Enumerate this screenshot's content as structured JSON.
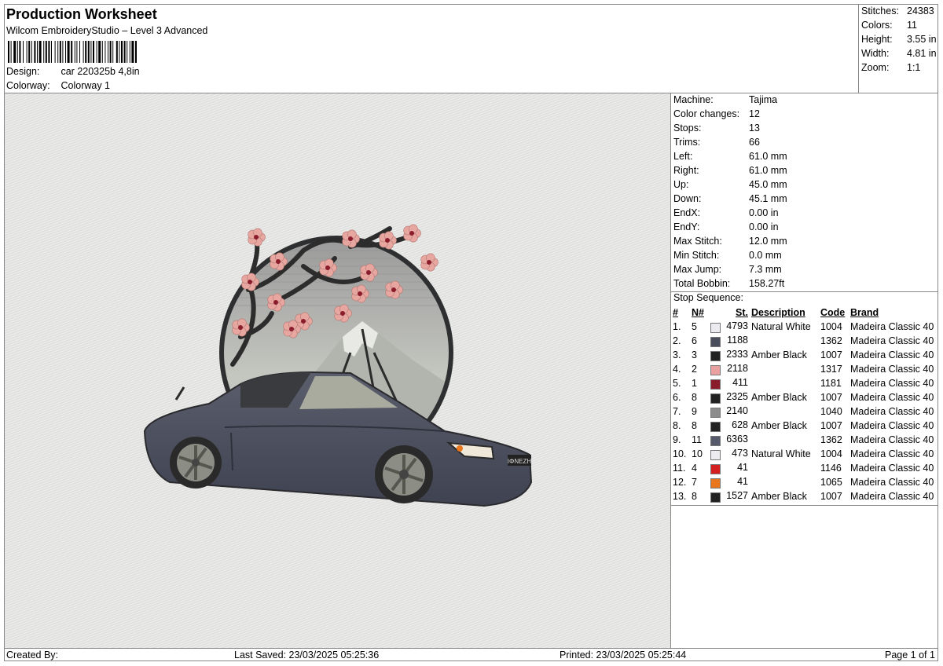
{
  "header": {
    "title": "Production Worksheet",
    "subtitle": "Wilcom EmbroideryStudio – Level 3 Advanced",
    "design_label": "Design:",
    "design_value": "car 220325b 4,8in",
    "colorway_label": "Colorway:",
    "colorway_value": "Colorway 1"
  },
  "stats": [
    {
      "k": "Stitches:",
      "v": "24383"
    },
    {
      "k": "Colors:",
      "v": "11"
    },
    {
      "k": "Height:",
      "v": "3.55 in"
    },
    {
      "k": "Width:",
      "v": "4.81 in"
    },
    {
      "k": "Zoom:",
      "v": "1:1"
    }
  ],
  "machine": [
    {
      "k": "Machine:",
      "v": "Tajima"
    },
    {
      "k": "Color changes:",
      "v": "12"
    },
    {
      "k": "Stops:",
      "v": "13"
    },
    {
      "k": "Trims:",
      "v": "66"
    },
    {
      "k": "Left:",
      "v": "61.0 mm"
    },
    {
      "k": "Right:",
      "v": "61.0 mm"
    },
    {
      "k": "Up:",
      "v": "45.0 mm"
    },
    {
      "k": "Down:",
      "v": "45.1 mm"
    },
    {
      "k": "EndX:",
      "v": "0.00 in"
    },
    {
      "k": "EndY:",
      "v": "0.00 in"
    },
    {
      "k": "Max Stitch:",
      "v": "12.0 mm"
    },
    {
      "k": "Min Stitch:",
      "v": "0.0 mm"
    },
    {
      "k": "Max Jump:",
      "v": "7.3 mm"
    },
    {
      "k": "Total Bobbin:",
      "v": "158.27ft"
    }
  ],
  "stop_sequence": {
    "title": "Stop Sequence:",
    "headers": [
      "#",
      "N#",
      "St.",
      "Description",
      "Code",
      "Brand"
    ],
    "rows": [
      {
        "i": "1.",
        "n": "5",
        "color": "#ececf0",
        "st": "4793",
        "desc": "Natural White",
        "code": "1004",
        "brand": "Madeira Classic 40"
      },
      {
        "i": "2.",
        "n": "6",
        "color": "#4a4d5c",
        "st": "1188",
        "desc": "",
        "code": "1362",
        "brand": "Madeira Classic 40"
      },
      {
        "i": "3.",
        "n": "3",
        "color": "#222222",
        "st": "2333",
        "desc": "Amber Black",
        "code": "1007",
        "brand": "Madeira Classic 40"
      },
      {
        "i": "4.",
        "n": "2",
        "color": "#e8a0a0",
        "st": "2118",
        "desc": "",
        "code": "1317",
        "brand": "Madeira Classic 40"
      },
      {
        "i": "5.",
        "n": "1",
        "color": "#8a1c2c",
        "st": "411",
        "desc": "",
        "code": "1181",
        "brand": "Madeira Classic 40"
      },
      {
        "i": "6.",
        "n": "8",
        "color": "#222222",
        "st": "2325",
        "desc": "Amber Black",
        "code": "1007",
        "brand": "Madeira Classic 40"
      },
      {
        "i": "7.",
        "n": "9",
        "color": "#8c8c8c",
        "st": "2140",
        "desc": "",
        "code": "1040",
        "brand": "Madeira Classic 40"
      },
      {
        "i": "8.",
        "n": "8",
        "color": "#222222",
        "st": "628",
        "desc": "Amber Black",
        "code": "1007",
        "brand": "Madeira Classic 40"
      },
      {
        "i": "9.",
        "n": "11",
        "color": "#575a6a",
        "st": "6363",
        "desc": "",
        "code": "1362",
        "brand": "Madeira Classic 40"
      },
      {
        "i": "10.",
        "n": "10",
        "color": "#ececf0",
        "st": "473",
        "desc": "Natural White",
        "code": "1004",
        "brand": "Madeira Classic 40"
      },
      {
        "i": "11.",
        "n": "4",
        "color": "#d42020",
        "st": "41",
        "desc": "",
        "code": "1146",
        "brand": "Madeira Classic 40"
      },
      {
        "i": "12.",
        "n": "7",
        "color": "#e8761c",
        "st": "41",
        "desc": "",
        "code": "1065",
        "brand": "Madeira Classic 40"
      },
      {
        "i": "13.",
        "n": "8",
        "color": "#222222",
        "st": "1527",
        "desc": "Amber Black",
        "code": "1007",
        "brand": "Madeira Classic 40"
      }
    ]
  },
  "footer": {
    "created_by": "Created By:",
    "last_saved": "Last Saved: 23/03/2025 05:25:36",
    "printed": "Printed: 23/03/2025 05:25:44",
    "page": "Page 1 of 1"
  },
  "plate_text": "ΙΦΝΕΖΗ"
}
